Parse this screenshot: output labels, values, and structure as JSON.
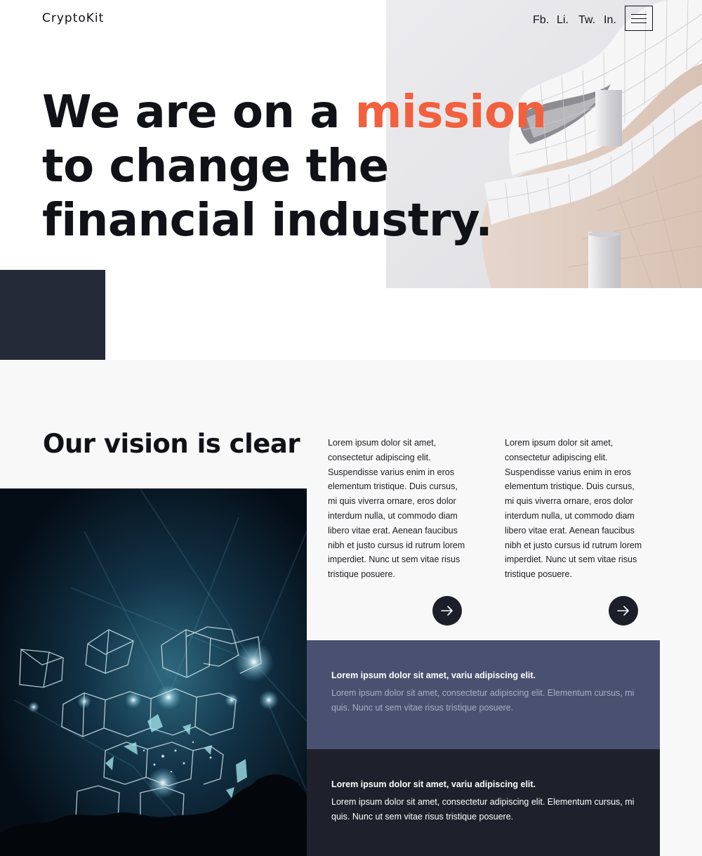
{
  "header": {
    "logo": "CryptoKit",
    "social": [
      {
        "label": "Fb."
      },
      {
        "label": "Li."
      },
      {
        "label": "Tw."
      },
      {
        "label": "In."
      }
    ],
    "menu_icon": "hamburger-icon"
  },
  "hero": {
    "headline_before": "We are on a ",
    "headline_accent": "mission",
    "headline_after": " to change the financial industry.",
    "accent_color": "#f2603d"
  },
  "vision": {
    "title": "Our vision is clear",
    "columns": [
      {
        "text": "Lorem ipsum dolor sit amet, consectetur adipiscing elit. Suspendisse varius enim in eros elementum tristique. Duis cursus, mi quis viverra ornare, eros dolor interdum nulla, ut commodo diam libero vitae erat. Aenean faucibus nibh et justo cursus id rutrum lorem imperdiet. Nunc ut sem vitae risus tristique posuere.",
        "arrow_icon": "arrow-right-icon"
      },
      {
        "text": "Lorem ipsum dolor sit amet, consectetur adipiscing elit. Suspendisse varius enim in eros elementum tristique. Duis cursus, mi quis viverra ornare, eros dolor interdum nulla, ut commodo diam libero vitae erat. Aenean faucibus nibh et justo cursus id rutrum lorem imperdiet. Nunc ut sem vitae risus tristique posuere.",
        "arrow_icon": "arrow-right-icon"
      }
    ],
    "panels": [
      {
        "title": "Lorem ipsum dolor sit amet, variu adipiscing elit.",
        "body": "Lorem ipsum dolor sit amet, consectetur adipiscing elit. Elementum cursus, mi quis. Nunc ut sem vitae risus tristique posuere."
      },
      {
        "title": "Lorem ipsum dolor sit amet, variu adipiscing elit.",
        "body": "Lorem ipsum dolor sit amet, consectetur adipiscing elit. Elementum cursus, mi quis. Nunc ut sem vitae risus tristique posuere."
      }
    ]
  },
  "colors": {
    "navy": "#252a38",
    "panel_blue": "#4a5170",
    "panel_dark": "#1e212b",
    "button": "#1c1f2a"
  }
}
